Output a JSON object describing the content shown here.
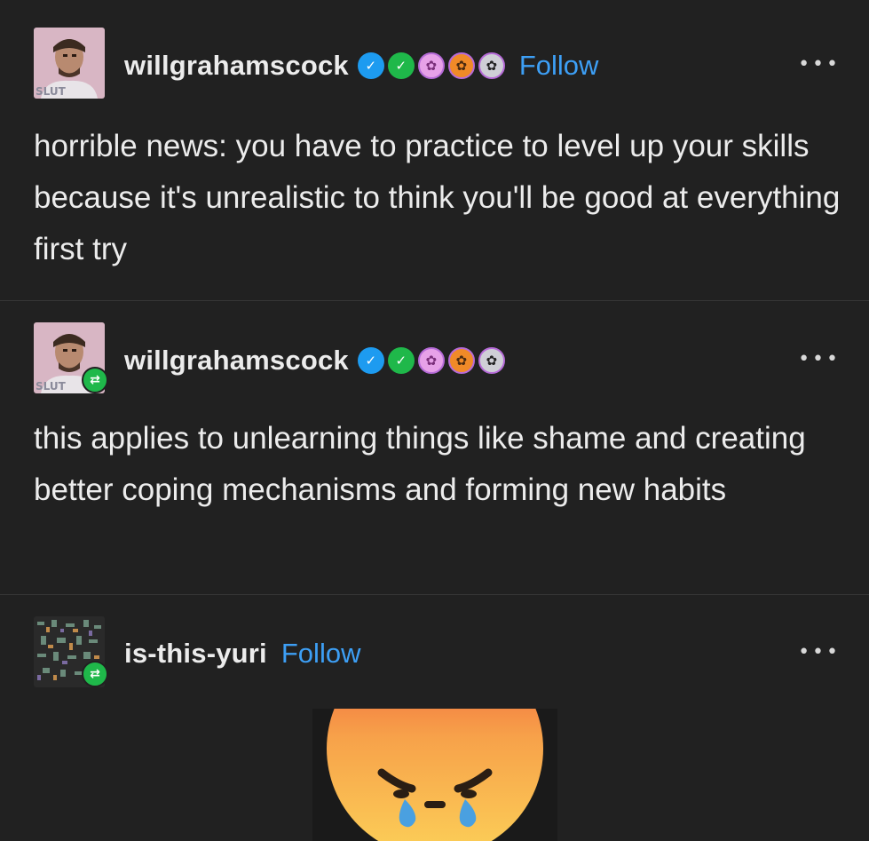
{
  "posts": [
    {
      "username": "willgrahamscock",
      "follow_label": "Follow",
      "avatar_label": "SLUT",
      "badges": [
        "verified-blue-icon",
        "verified-green-icon",
        "paw-pink-icon",
        "paw-orange-icon",
        "paw-gray-icon"
      ],
      "more_label": "•••",
      "text": "horrible news: you have to practice to level up your skills because it's unrealistic to think you'll be good at everything first try"
    },
    {
      "username": "willgrahamscock",
      "avatar_label": "SLUT",
      "reblog_icon": "⇄",
      "badges": [
        "verified-blue-icon",
        "verified-green-icon",
        "paw-pink-icon",
        "paw-orange-icon",
        "paw-gray-icon"
      ],
      "more_label": "•••",
      "text": "this applies to unlearning things like shame and creating better coping mechanisms and forming new habits"
    },
    {
      "username": "is-this-yuri",
      "follow_label": "Follow",
      "reblog_icon": "⇄",
      "more_label": "•••",
      "image": "crying-angry-emoji"
    }
  ],
  "colors": {
    "background": "#212121",
    "text": "#ececec",
    "follow": "#3d9ff5",
    "reblog_badge": "#1fb84a",
    "divider": "#353535"
  }
}
